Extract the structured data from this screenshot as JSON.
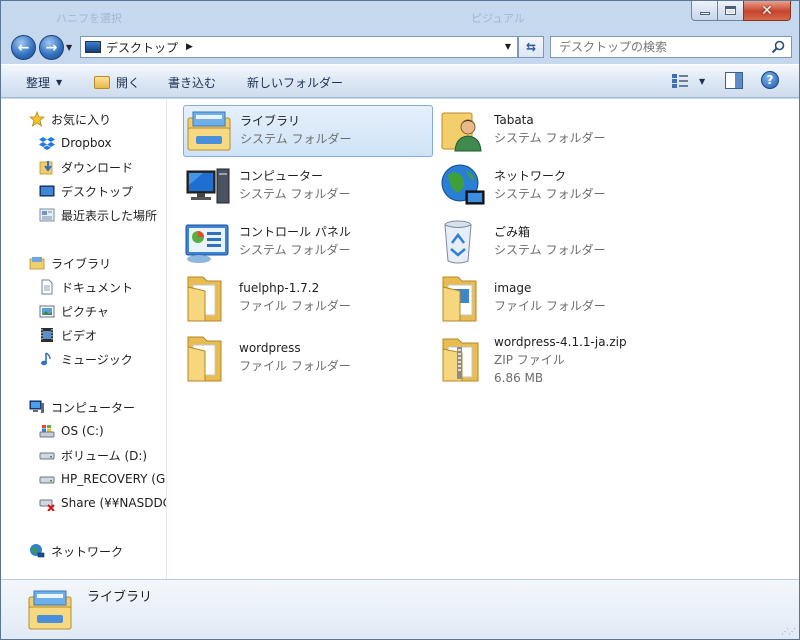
{
  "window": {
    "ghost_title_left": "ハニフを選択",
    "ghost_title_right": "ピジュアル"
  },
  "nav": {
    "address": "デスクトップ",
    "search_placeholder": "デスクトップの検索"
  },
  "toolbar": {
    "organize": "整理",
    "open": "開く",
    "burn": "書き込む",
    "new_folder": "新しいフォルダー"
  },
  "sidebar": {
    "favorites": {
      "label": "お気に入り",
      "items": [
        {
          "label": "Dropbox",
          "icon": "dropbox-icon"
        },
        {
          "label": "ダウンロード",
          "icon": "download-folder-icon"
        },
        {
          "label": "デスクトップ",
          "icon": "desktop-icon"
        },
        {
          "label": "最近表示した場所",
          "icon": "recent-places-icon"
        }
      ]
    },
    "libraries": {
      "label": "ライブラリ",
      "items": [
        {
          "label": "ドキュメント",
          "icon": "documents-icon"
        },
        {
          "label": "ピクチャ",
          "icon": "pictures-icon"
        },
        {
          "label": "ビデオ",
          "icon": "videos-icon"
        },
        {
          "label": "ミュージック",
          "icon": "music-icon"
        }
      ]
    },
    "computer": {
      "label": "コンピューター",
      "items": [
        {
          "label": "OS (C:)",
          "icon": "os-drive-icon"
        },
        {
          "label": "ボリューム (D:)",
          "icon": "drive-icon"
        },
        {
          "label": "HP_RECOVERY (G",
          "icon": "drive-icon"
        },
        {
          "label": "Share (¥¥NASDDC",
          "icon": "network-drive-disconnected-icon"
        }
      ]
    },
    "network": {
      "label": "ネットワーク"
    }
  },
  "files": [
    {
      "name": "ライブラリ",
      "type": "システム フォルダー",
      "icon": "libraries-icon",
      "selected": true
    },
    {
      "name": "Tabata",
      "type": "システム フォルダー",
      "icon": "user-folder-icon"
    },
    {
      "name": "コンピューター",
      "type": "システム フォルダー",
      "icon": "computer-icon"
    },
    {
      "name": "ネットワーク",
      "type": "システム フォルダー",
      "icon": "network-icon"
    },
    {
      "name": "コントロール パネル",
      "type": "システム フォルダー",
      "icon": "control-panel-icon"
    },
    {
      "name": "ごみ箱",
      "type": "システム フォルダー",
      "icon": "recycle-bin-icon"
    },
    {
      "name": "fuelphp-1.7.2",
      "type": "ファイル フォルダー",
      "icon": "folder-icon"
    },
    {
      "name": "image",
      "type": "ファイル フォルダー",
      "icon": "folder-icon"
    },
    {
      "name": "wordpress",
      "type": "ファイル フォルダー",
      "icon": "folder-icon"
    },
    {
      "name": "wordpress-4.1.1-ja.zip",
      "type": "ZIP ファイル",
      "size": "6.86 MB",
      "icon": "zip-folder-icon"
    }
  ],
  "details": {
    "selected_name": "ライブラリ"
  },
  "colors": {
    "accent": "#2f6fbd",
    "selection": "#cfe3f8",
    "folder": "#f3cf6b"
  }
}
